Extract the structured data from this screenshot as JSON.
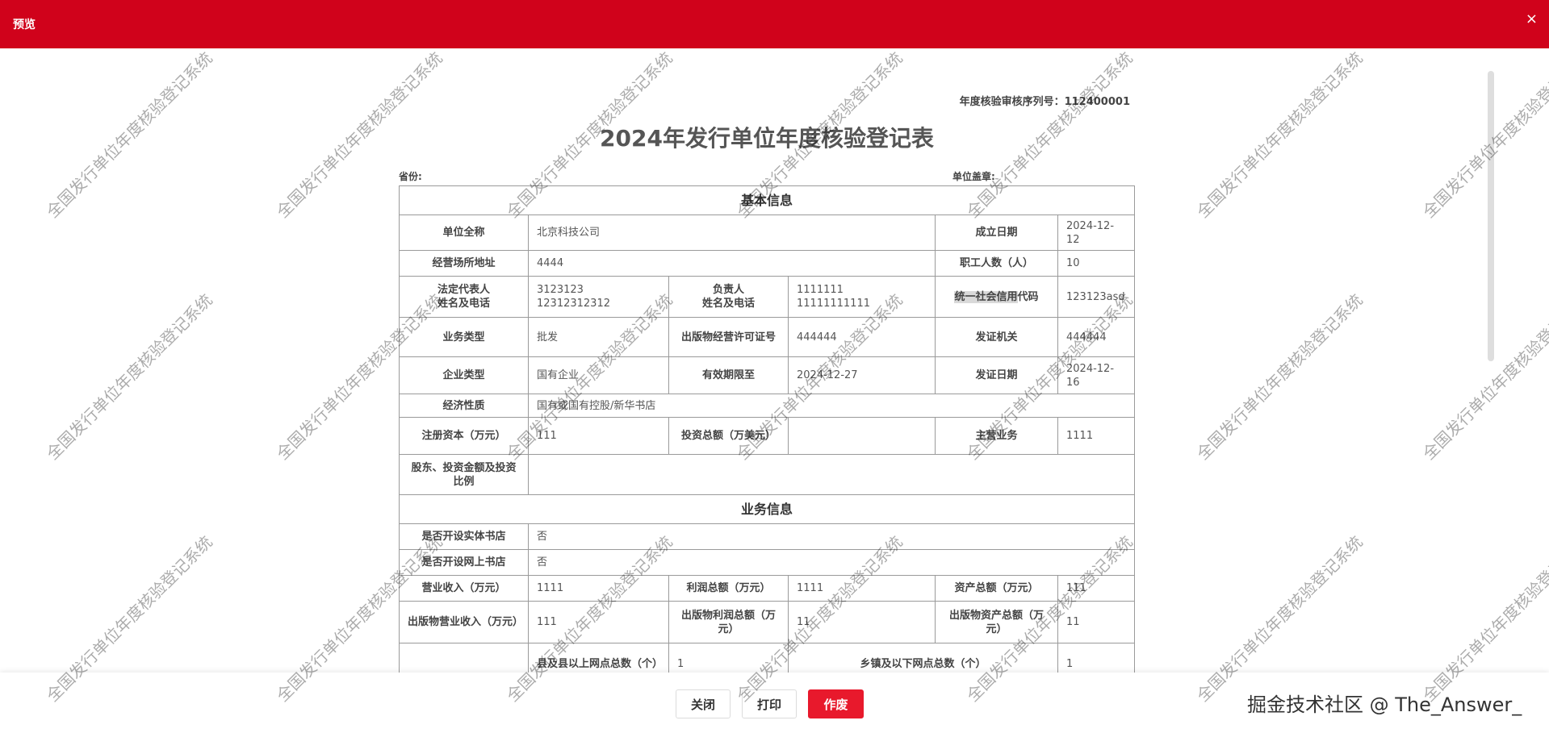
{
  "window": {
    "title": "预览",
    "close_glyph": "×"
  },
  "document": {
    "serial_label": "年度核验审核序列号：",
    "serial_value": "112400001",
    "title": "2024年发行单位年度核验登记表",
    "province_label": "省份:",
    "seal_label": "单位盖章:",
    "sections": {
      "basic": "基本信息",
      "business": "业务信息"
    },
    "basic": {
      "name_label": "单位全称",
      "name_value": "北京科技公司",
      "found_label": "成立日期",
      "found_value": "2024-12-12",
      "addr_label": "经营场所地址",
      "addr_value": "4444",
      "staff_label": "职工人数（人）",
      "staff_value": "10",
      "legal_label_1": "法定代表人",
      "legal_label_2": "姓名及电话",
      "legal_name": "3123123",
      "legal_phone": "12312312312",
      "manager_label_1": "负责人",
      "manager_label_2": "姓名及电话",
      "manager_name": "1111111",
      "manager_phone": "11111111111",
      "uscc_label_hl": "统一社会信用",
      "uscc_label_rest": "代码",
      "uscc_value": "123123asd",
      "biz_type_label": "业务类型",
      "biz_type_value": "批发",
      "license_label": "出版物经营许可证号",
      "license_value": "444444",
      "issuer_label": "发证机关",
      "issuer_value": "444444",
      "ent_type_label": "企业类型",
      "ent_type_value": "国有企业",
      "valid_label": "有效期限至",
      "valid_value": "2024-12-27",
      "issue_date_label": "发证日期",
      "issue_date_value": "2024-12-16",
      "econ_label": "经济性质",
      "econ_value": "国有或国有控股/新华书店",
      "capital_label": "注册资本（万元）",
      "capital_value": "111",
      "invest_label": "投资总额（万美元）",
      "invest_value": "",
      "main_biz_label": "主营业务",
      "main_biz_value": "1111",
      "shareholder_label": "股东、投资金额及投资比例",
      "shareholder_value": ""
    },
    "business": {
      "physical_label": "是否开设实体书店",
      "physical_value": "否",
      "online_label": "是否开设网上书店",
      "online_value": "否",
      "revenue_label": "营业收入（万元）",
      "revenue_value": "1111",
      "profit_label": "利润总额（万元）",
      "profit_value": "1111",
      "assets_label": "资产总额（万元）",
      "assets_value": "111",
      "pub_revenue_label": "出版物营业收入（万元）",
      "pub_revenue_value": "111",
      "pub_profit_label": "出版物利润总额（万元）",
      "pub_profit_value": "11",
      "pub_assets_label": "出版物资产总额（万元）",
      "pub_assets_value": "11",
      "county_outlets_label": "县及县以上网点总数（个）",
      "county_outlets_value": "1",
      "town_outlets_label": "乡镇及以下网点总数（个）",
      "town_outlets_value": "1"
    }
  },
  "footer": {
    "close_label": "关闭",
    "print_label": "打印",
    "void_label": "作废",
    "brand": "掘金技术社区 @ The_Answer_"
  },
  "watermark": {
    "text": "全国发行单位年度核验登记系统"
  },
  "colors": {
    "header": "#d0021b",
    "primary_button": "#e8192c"
  }
}
